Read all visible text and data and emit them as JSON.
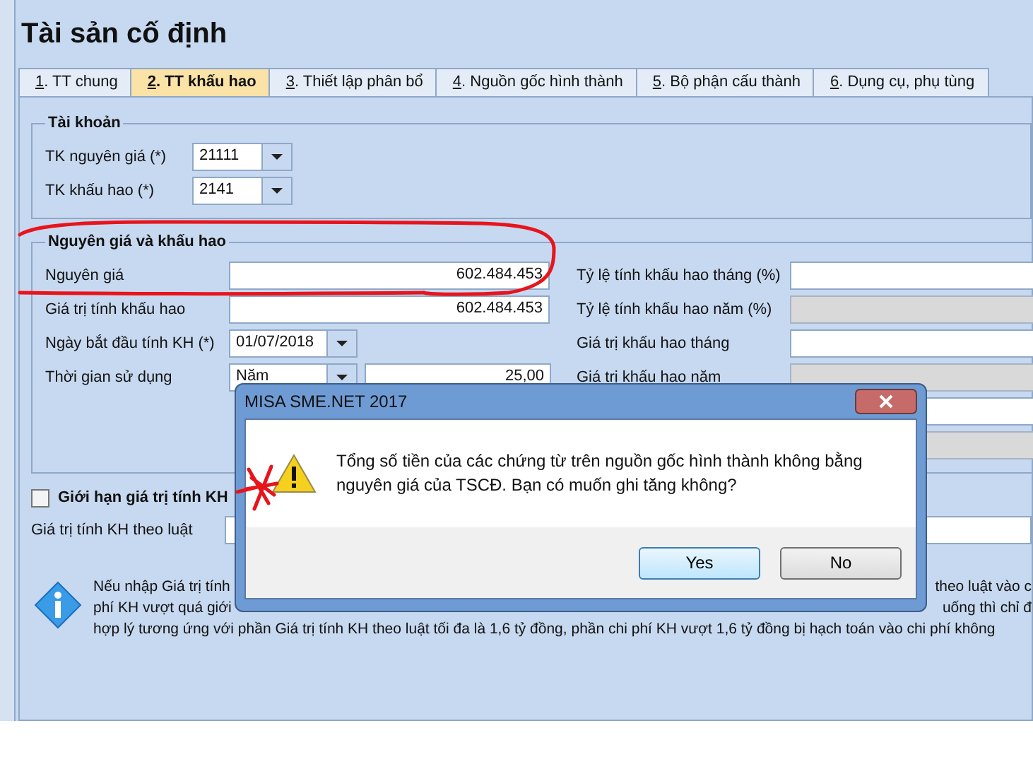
{
  "title": "Tài sản cố định",
  "tabs": [
    {
      "mnemonic": "1",
      "label": ". TT chung",
      "selected": false
    },
    {
      "mnemonic": "2",
      "label": ". TT khấu hao",
      "selected": true
    },
    {
      "mnemonic": "3",
      "label": ". Thiết lập phân bổ",
      "selected": false
    },
    {
      "mnemonic": "4",
      "label": ". Nguồn gốc hình thành",
      "selected": false
    },
    {
      "mnemonic": "5",
      "label": ". Bộ phận cấu thành",
      "selected": false
    },
    {
      "mnemonic": "6",
      "label": ". Dụng cụ, phụ tùng",
      "selected": false
    }
  ],
  "accounts": {
    "title": "Tài khoản",
    "fields": [
      {
        "label": "TK nguyên giá (*)",
        "value": "21111"
      },
      {
        "label": "TK khấu hao (*)",
        "value": "2141"
      }
    ]
  },
  "depreciation": {
    "title": "Nguyên giá và khấu hao",
    "left_rows": [
      {
        "kind": "number",
        "label": "Nguyên giá",
        "value": "602.484.453"
      },
      {
        "kind": "number",
        "label": "Giá trị tính khấu hao",
        "value": "602.484.453"
      },
      {
        "kind": "date",
        "label": "Ngày bắt đầu tính KH (*)",
        "value": "01/07/2018"
      },
      {
        "kind": "period",
        "label": "Thời gian sử dụng",
        "unit": "Năm",
        "value": "25,00"
      }
    ],
    "right_rows": [
      {
        "label": "Tỷ lệ tính khấu hao tháng (%)",
        "disabled": false
      },
      {
        "label": "Tỷ lệ tính khấu hao năm (%)",
        "disabled": true
      },
      {
        "label": "Giá trị khấu hao tháng",
        "disabled": false
      },
      {
        "label": "Giá trị khấu hao năm",
        "disabled": true
      },
      {
        "disabled": false
      },
      {
        "disabled": true
      }
    ]
  },
  "limit": {
    "label": "Giới hạn giá trị tính KH",
    "checked": false
  },
  "law_field": {
    "label": "Giá trị tính KH theo luật"
  },
  "info_lines": [
    {
      "left": "Nếu nhập Giá trị tính",
      "right": "theo luật vào c"
    },
    {
      "left": "phí KH vượt quá giới",
      "right": "uống thì chỉ đ"
    },
    {
      "left": "hợp lý tương ứng với phần Giá trị tính KH theo luật tối đa là 1,6 tỷ đồng, phần chi phí KH vượt 1,6 tỷ đồng bị hạch toán vào chi phí không"
    }
  ],
  "dialog": {
    "title": "MISA SME.NET 2017",
    "message": "Tổng số tiền của các chứng từ trên nguồn gốc hình thành không bằng nguyên giá của TSCĐ. Bạn có muốn ghi tăng không?",
    "buttons": [
      {
        "label": "Yes",
        "selected": true
      },
      {
        "label": "No",
        "selected": false
      }
    ]
  }
}
